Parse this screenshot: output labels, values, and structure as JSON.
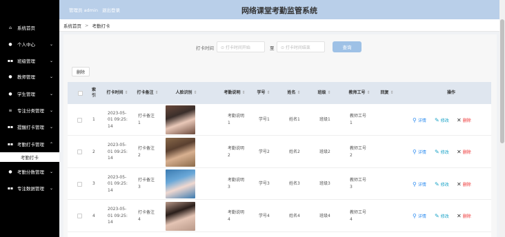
{
  "header": {
    "user_label": "管理员 admin",
    "logout": "退出登录",
    "title": "网络课堂考勤监管系统"
  },
  "breadcrumb": {
    "home": "系统首页",
    "sep": ">",
    "current": "考勤打卡"
  },
  "sidebar": {
    "items": [
      {
        "label": "系统首页",
        "icon": "home-icon",
        "glyph": "⌂",
        "chevron": ""
      },
      {
        "label": "个人中心",
        "icon": "user-icon",
        "glyph": "●",
        "chevron": "⌄"
      },
      {
        "label": "班级管理",
        "icon": "grid-icon",
        "glyph": "▪▪",
        "chevron": "⌄"
      },
      {
        "label": "教师管理",
        "icon": "location-icon",
        "glyph": "●",
        "chevron": "⌄"
      },
      {
        "label": "学生管理",
        "icon": "user-icon",
        "glyph": "●",
        "chevron": "⌄"
      },
      {
        "label": "专注分类管理",
        "icon": "list-icon",
        "glyph": "≡",
        "chevron": "⌄"
      },
      {
        "label": "提醒打卡管理",
        "icon": "grid-icon",
        "glyph": "▪▪",
        "chevron": "⌄"
      },
      {
        "label": "考勤打卡管理",
        "icon": "grid-icon",
        "glyph": "▪▪",
        "chevron": "⌃"
      },
      {
        "label": "考勤分数管理",
        "icon": "user-icon",
        "glyph": "●",
        "chevron": "⌄"
      },
      {
        "label": "专注数据管理",
        "icon": "grid-icon",
        "glyph": "▪▪",
        "chevron": "⌄"
      }
    ],
    "subitem": "考勤打卡"
  },
  "search": {
    "label": "打卡时间",
    "start_placeholder": "⊙ 打卡时间开始",
    "to": "至",
    "end_placeholder": "⊙ 打卡时间结束",
    "button": "查询"
  },
  "toolbar": {
    "delete_label": "删除"
  },
  "table": {
    "headers": {
      "index": "索\n引",
      "time": "打卡时间",
      "note": "打卡备注",
      "photo": "人脸识别",
      "desc": "考勤说明",
      "student_no": "学号",
      "name": "姓名",
      "class": "班级",
      "teacher_no": "教师工号",
      "reply": "回复",
      "actions": "操作"
    },
    "sort_glyph": "⇕",
    "rows": [
      {
        "index": "1",
        "time": "2023-05-\n01 09:25:\n14",
        "note": "打卡备注\n1",
        "desc": "考勤说明\n1",
        "student_no": "学号1",
        "name": "姓名1",
        "class": "班级1",
        "teacher_no": "教师工号\n1"
      },
      {
        "index": "2",
        "time": "2023-05-\n01 09:25:\n14",
        "note": "打卡备注\n2",
        "desc": "考勤说明\n2",
        "student_no": "学号2",
        "name": "姓名2",
        "class": "班级2",
        "teacher_no": "教师工号\n2"
      },
      {
        "index": "3",
        "time": "2023-05-\n01 09:25:\n14",
        "note": "打卡备注\n3",
        "desc": "考勤说明\n3",
        "student_no": "学号3",
        "name": "姓名3",
        "class": "班级3",
        "teacher_no": "教师工号\n3"
      },
      {
        "index": "4",
        "time": "2023-05-\n01 09:25:\n14",
        "note": "打卡备注\n4",
        "desc": "考勤说明\n4",
        "student_no": "学号4",
        "name": "姓名4",
        "class": "班级4",
        "teacher_no": "教师工号\n4"
      }
    ],
    "actions": {
      "detail": "详情",
      "edit": "修改",
      "delete": "删除"
    }
  }
}
